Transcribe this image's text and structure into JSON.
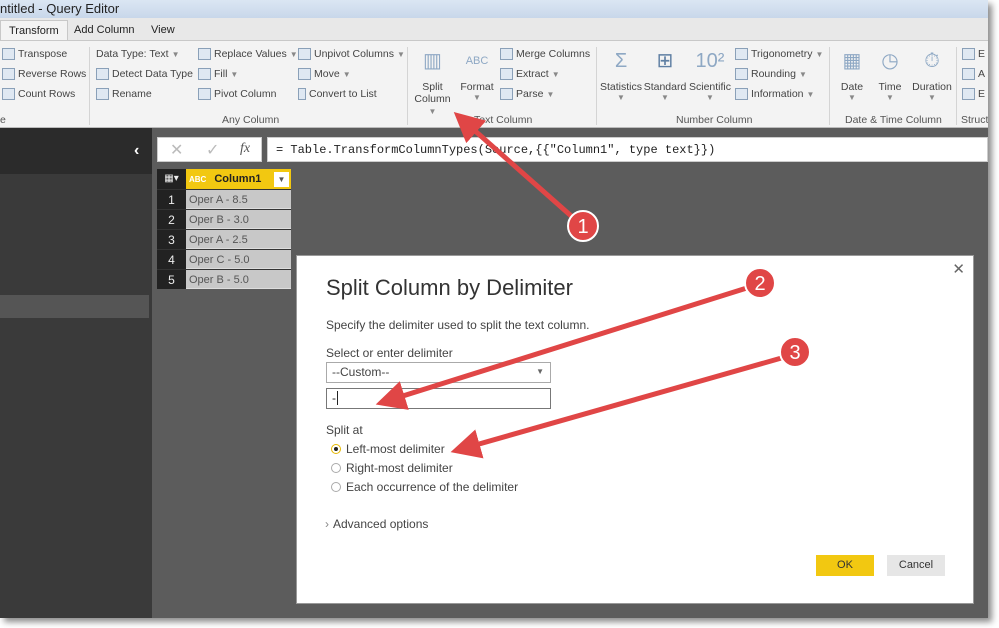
{
  "window": {
    "title": "ntitled - Query Editor"
  },
  "tabs": [
    {
      "label": "Transform",
      "active": true
    },
    {
      "label": "Add Column"
    },
    {
      "label": "View"
    }
  ],
  "ribbon": {
    "table_group": {
      "items": [
        "Transpose",
        "Reverse Rows",
        "Count Rows"
      ],
      "label": "e"
    },
    "any_column": {
      "label": "Any Column",
      "items": [
        "Data Type: Text",
        "Detect Data Type",
        "Rename",
        "Replace Values",
        "Fill",
        "Pivot Column",
        "Unpivot Columns",
        "Move",
        "Convert to List"
      ]
    },
    "text_column": {
      "label": "Text Column",
      "split_1": "Split",
      "split_2": "Column",
      "format": "Format",
      "items": [
        "Merge Columns",
        "Extract",
        "Parse"
      ]
    },
    "number_column": {
      "label": "Number Column",
      "big": [
        "Statistics",
        "Standard",
        "Scientific"
      ],
      "items": [
        "Trigonometry",
        "Rounding",
        "Information"
      ]
    },
    "datetime_column": {
      "label": "Date & Time Column",
      "big": [
        "Date",
        "Time",
        "Duration"
      ]
    },
    "structured": {
      "label": "Struct",
      "items": [
        "E",
        "A",
        "E"
      ]
    }
  },
  "formula_bar": {
    "cancel": "✕",
    "confirm": "✓",
    "fx": "fx",
    "formula": "= Table.TransformColumnTypes(Source,{{\"Column1\", type text}})"
  },
  "table": {
    "header": "Column1",
    "type_icon": "ABC",
    "rows": [
      "Oper A - 8.5",
      "Oper B - 3.0",
      "Oper A - 2.5",
      "Oper C - 5.0",
      "Oper B - 5.0"
    ]
  },
  "dialog": {
    "title": "Split Column by Delimiter",
    "description": "Specify the delimiter used to split the text column.",
    "delimiter_label": "Select or enter delimiter",
    "delimiter_selected": "--Custom--",
    "custom_value": "-",
    "split_at_label": "Split at",
    "options": [
      "Left-most delimiter",
      "Right-most delimiter",
      "Each occurrence of the delimiter"
    ],
    "selected_option": 0,
    "advanced": "Advanced options",
    "ok": "OK",
    "cancel": "Cancel",
    "close": "✕"
  },
  "annotations": {
    "markers": [
      "1",
      "2",
      "3"
    ],
    "color": "#e04646"
  },
  "colors": {
    "accent": "#f2c811",
    "ok_button": "#f2c811"
  }
}
